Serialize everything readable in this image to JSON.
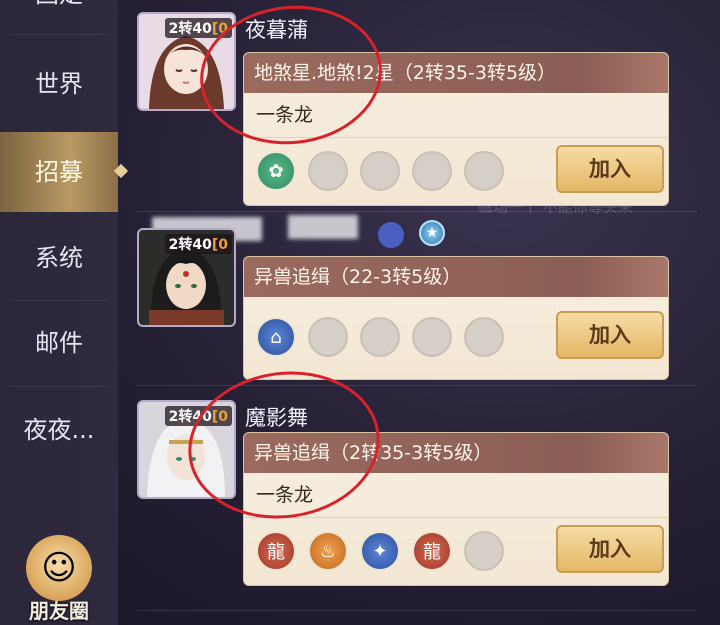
{
  "sidebar": {
    "items": [
      {
        "label": "固定",
        "active": false
      },
      {
        "label": "世界",
        "active": false
      },
      {
        "label": "招募",
        "active": true
      },
      {
        "label": "系统",
        "active": false
      },
      {
        "label": "邮件",
        "active": false
      },
      {
        "label": "夜夜...",
        "active": false
      }
    ],
    "friend_circle_label": "朋友圈"
  },
  "rows": [
    {
      "level_prefix": "2转40",
      "level_suffix": "[0",
      "name": "夜暮蒲",
      "title": "地煞星.地煞!2星（2转35-3转5级）",
      "description": "一条龙",
      "join_label": "加入"
    },
    {
      "level_prefix": "2转40",
      "level_suffix": "[0",
      "name": "",
      "title": "异兽追缉（22-3转5级）",
      "description": "",
      "join_label": "加入"
    },
    {
      "level_prefix": "2转40",
      "level_suffix": "[0",
      "name": "魔影舞",
      "title": "异兽追缉（2转35-3转5级）",
      "description": "一条龙",
      "join_label": "加入"
    }
  ],
  "background_text": "磁场一个 不能你等头来",
  "colors": {
    "accent_gold": "#e4b766",
    "annotation_red": "#d8222a",
    "title_bar": "#8b5e55"
  }
}
